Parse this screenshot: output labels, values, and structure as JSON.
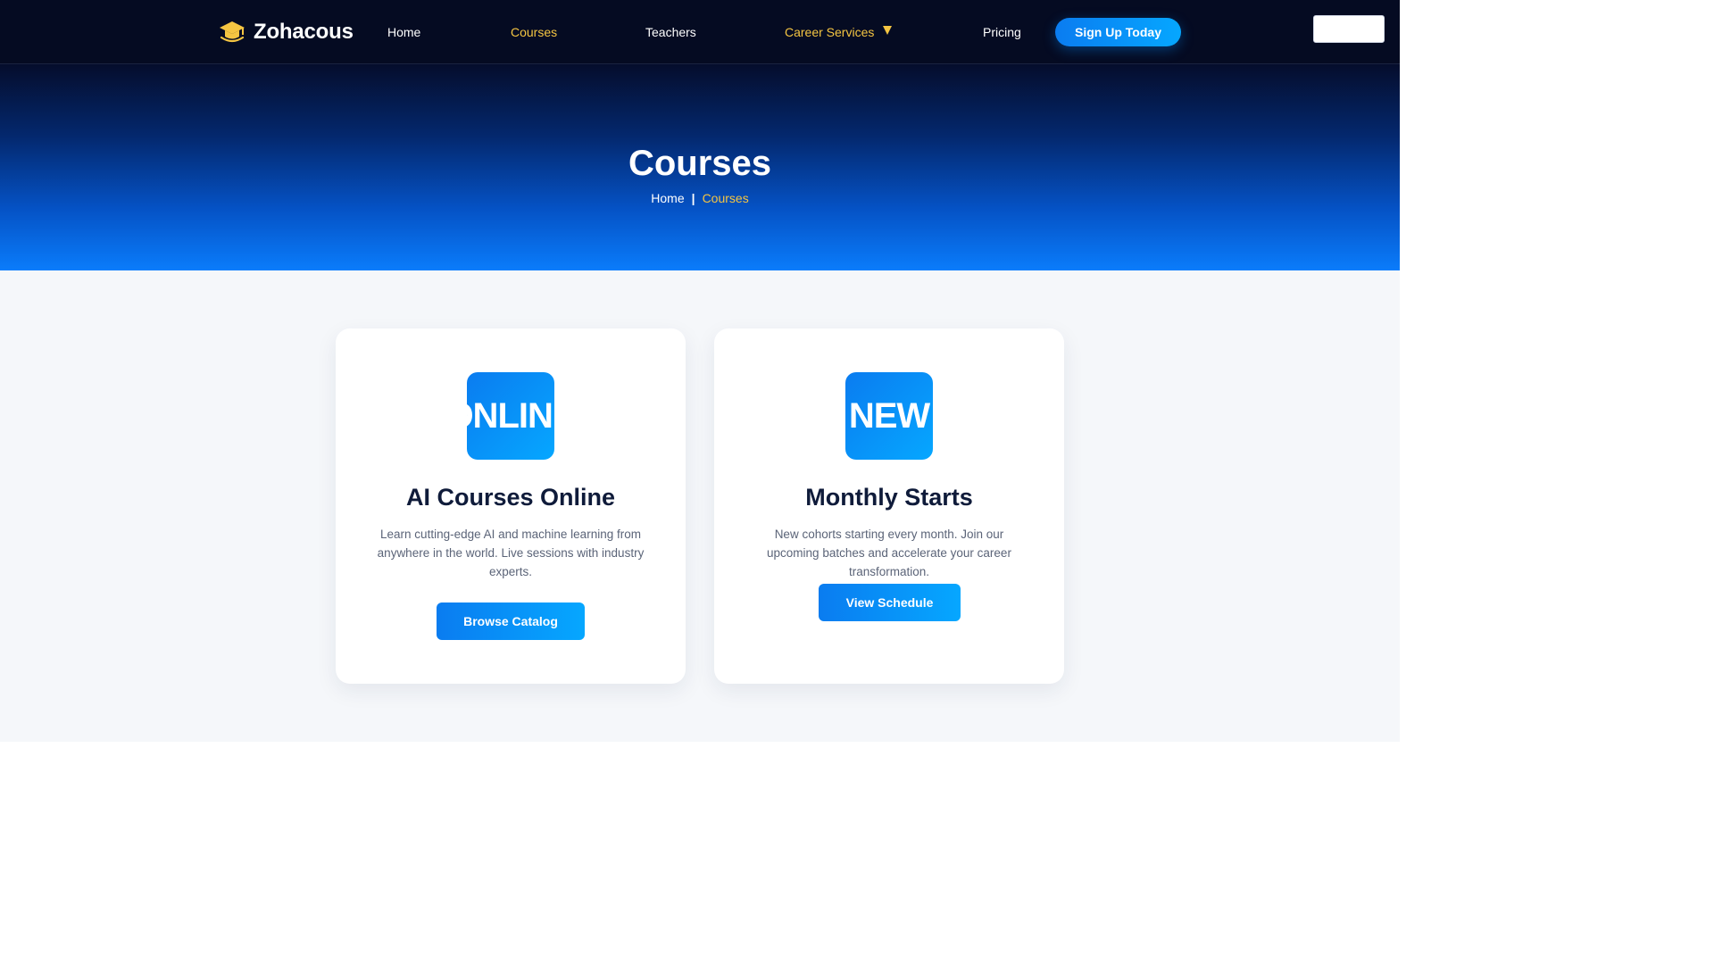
{
  "brand": {
    "name": "Zohacous",
    "icon": "graduation-cap-icon",
    "accent": "#f5c542"
  },
  "nav": {
    "home": "Home",
    "courses": "Courses",
    "teachers": "Teachers",
    "career_services": "Career Services",
    "pricing": "Pricing",
    "signup": "Sign Up Today",
    "active_color": "#f5c542"
  },
  "hero": {
    "title": "Courses",
    "breadcrumb": {
      "home": "Home",
      "separator": "|",
      "current": "Courses"
    }
  },
  "cards": [
    {
      "badge": "ONLINE",
      "title": "AI Courses Online",
      "description": "Learn cutting-edge AI and machine learning from anywhere in the world. Live sessions with industry experts.",
      "button": "Browse Catalog"
    },
    {
      "badge": "NEW",
      "title": "Monthly Starts",
      "description": "New cohorts starting every month. Join our upcoming batches and accelerate your career transformation.",
      "button": "View Schedule"
    }
  ],
  "colors": {
    "primary": "#0a7cf0",
    "primary_light": "#06a7ff",
    "dark": "#050b22",
    "heading": "#0f1b3a"
  }
}
